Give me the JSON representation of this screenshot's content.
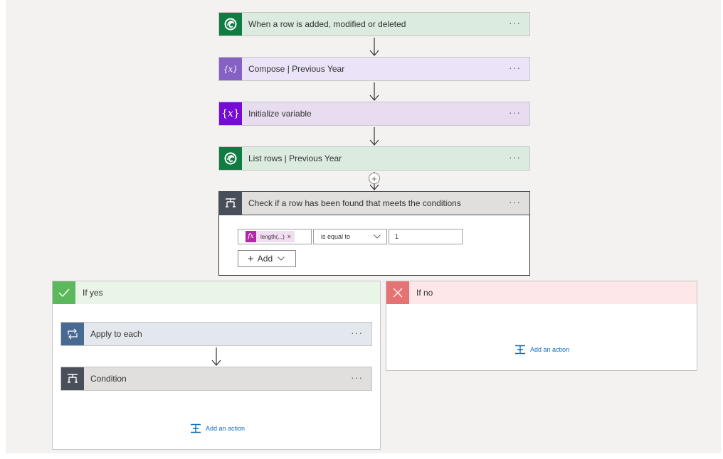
{
  "flow": {
    "trigger": {
      "label": "When a row is added, modified or deleted",
      "more": "···"
    },
    "compose": {
      "label": "Compose | Previous Year",
      "more": "···"
    },
    "init_var": {
      "label": "Initialize variable",
      "more": "···"
    },
    "list_rows": {
      "label": "List rows | Previous Year",
      "more": "···"
    },
    "insert_step": "+",
    "condition": {
      "label": "Check if a row has been found that meets the conditions",
      "more": "···",
      "row": {
        "token_fx": "fx",
        "token_label": "length(...)",
        "token_remove": "×",
        "operator": "is equal to",
        "value": "1"
      },
      "add_button": "Add"
    },
    "if_yes": {
      "label": "If yes",
      "actions": [
        {
          "label": "Apply to each",
          "more": "···"
        },
        {
          "label": "Condition",
          "more": "···"
        }
      ],
      "add_action": "Add an action"
    },
    "if_no": {
      "label": "If no",
      "add_action": "Add an action"
    }
  },
  "colors": {
    "dataverse": "#107c41",
    "dataverse_bg": "#dcebdf",
    "compose": "#8661c5",
    "compose_bg": "#ebe3f7",
    "variable": "#770bd6",
    "variable_bg": "#e8dcf1",
    "control": "#484f58",
    "control_bg": "#e1dfdd",
    "loop": "#486991",
    "loop_bg": "#e3e8ee",
    "yes": "#5cb85c",
    "yes_bg": "#e9f5e7",
    "no": "#e57373",
    "no_bg": "#fde7e9",
    "link": "#0f6cbd"
  },
  "icons": {
    "trigger": "dataverse-icon",
    "compose": "compose-expression-icon",
    "init_var": "variable-icon",
    "list_rows": "dataverse-icon",
    "condition": "condition-icon",
    "apply_to_each": "loop-icon",
    "yes": "checkmark-icon",
    "no": "close-icon",
    "add_action": "add-action-icon"
  }
}
